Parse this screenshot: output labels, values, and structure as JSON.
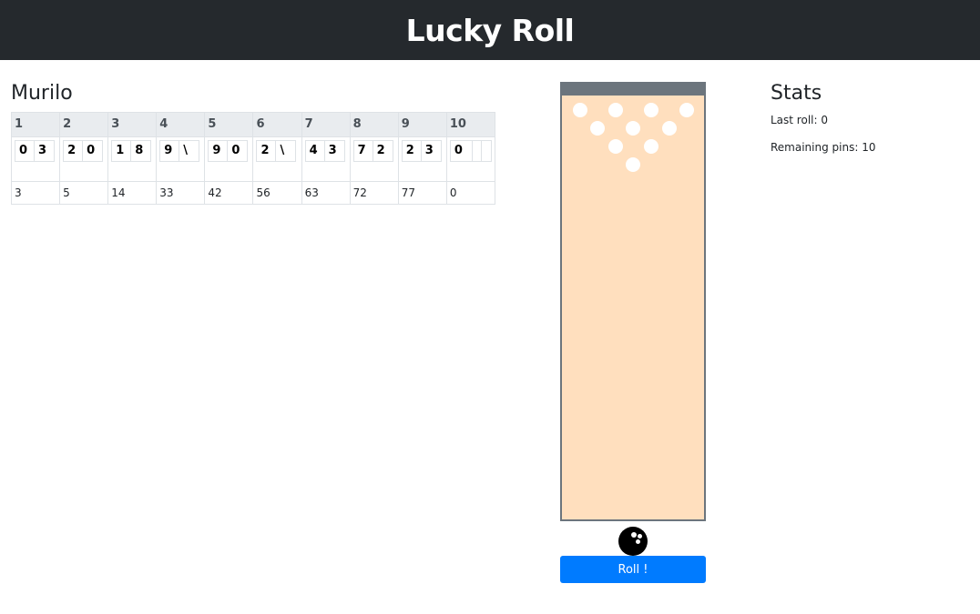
{
  "app": {
    "title": "Lucky Roll"
  },
  "player": {
    "name": "Murilo"
  },
  "frames": [
    {
      "label": "1",
      "rolls": [
        "0",
        "3"
      ],
      "total": "3"
    },
    {
      "label": "2",
      "rolls": [
        "2",
        "0"
      ],
      "total": "5"
    },
    {
      "label": "3",
      "rolls": [
        "1",
        "8"
      ],
      "total": "14"
    },
    {
      "label": "4",
      "rolls": [
        "9",
        "\\"
      ],
      "total": "33"
    },
    {
      "label": "5",
      "rolls": [
        "9",
        "0"
      ],
      "total": "42"
    },
    {
      "label": "6",
      "rolls": [
        "2",
        "\\"
      ],
      "total": "56"
    },
    {
      "label": "7",
      "rolls": [
        "4",
        "3"
      ],
      "total": "63"
    },
    {
      "label": "8",
      "rolls": [
        "7",
        "2"
      ],
      "total": "72"
    },
    {
      "label": "9",
      "rolls": [
        "2",
        "3"
      ],
      "total": "77"
    },
    {
      "label": "10",
      "rolls": [
        "0",
        "",
        ""
      ],
      "total": "0"
    }
  ],
  "lane": {
    "remaining_pins_visible": 10
  },
  "actions": {
    "roll_label": "Roll !"
  },
  "stats": {
    "title": "Stats",
    "last_roll_label": "Last roll:",
    "last_roll_value": "0",
    "remaining_pins_label": "Remaining pins:",
    "remaining_pins_value": "10"
  },
  "colors": {
    "header_bg": "#25292d",
    "lane_bg": "#ffdfbe",
    "lane_border": "#6c757d",
    "button_bg": "#007bff"
  },
  "icons": {
    "ball": "bowling-ball-icon",
    "pin": "bowling-pin-icon"
  }
}
